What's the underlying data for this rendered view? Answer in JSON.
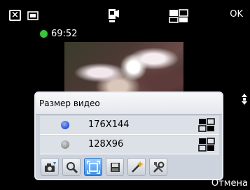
{
  "topbar": {
    "close_icon": "close-icon",
    "memory_icon": "memory-card-icon",
    "camera_icon": "video-camera-icon",
    "resolution_icon": "resolution-icon",
    "ok_label": "OK"
  },
  "recording": {
    "time": "69:52",
    "indicator_color": "#39c43a"
  },
  "popup": {
    "title": "Размер видео",
    "options": [
      {
        "label": "176X144",
        "selected": true
      },
      {
        "label": "128X96",
        "selected": false
      }
    ],
    "toolbar": [
      {
        "icon": "camera-mode-icon",
        "active": false
      },
      {
        "icon": "zoom-icon",
        "active": false
      },
      {
        "icon": "video-size-icon",
        "active": true
      },
      {
        "icon": "storage-icon",
        "active": false
      },
      {
        "icon": "white-balance-icon",
        "active": false
      },
      {
        "icon": "settings-tools-icon",
        "active": false
      }
    ]
  },
  "softkey": {
    "cancel_label": "Отмена"
  }
}
